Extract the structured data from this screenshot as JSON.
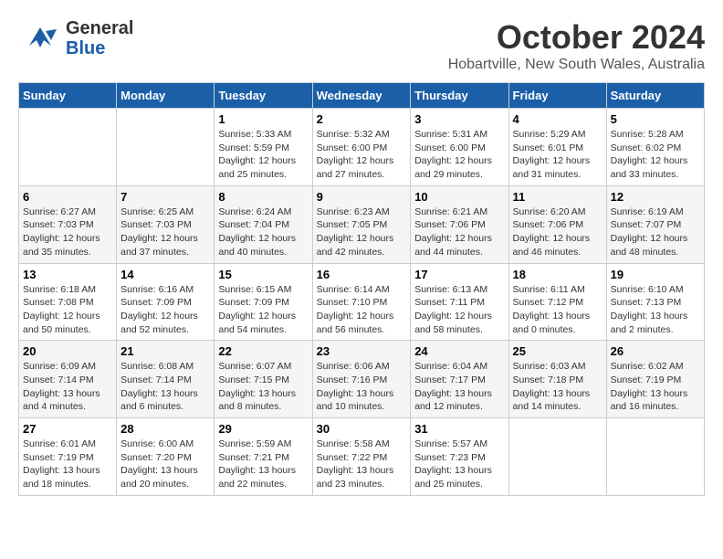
{
  "header": {
    "logo_general": "General",
    "logo_blue": "Blue",
    "month": "October 2024",
    "location": "Hobartville, New South Wales, Australia"
  },
  "days_of_week": [
    "Sunday",
    "Monday",
    "Tuesday",
    "Wednesday",
    "Thursday",
    "Friday",
    "Saturday"
  ],
  "weeks": [
    [
      {
        "day": "",
        "info": ""
      },
      {
        "day": "",
        "info": ""
      },
      {
        "day": "1",
        "info": "Sunrise: 5:33 AM\nSunset: 5:59 PM\nDaylight: 12 hours\nand 25 minutes."
      },
      {
        "day": "2",
        "info": "Sunrise: 5:32 AM\nSunset: 6:00 PM\nDaylight: 12 hours\nand 27 minutes."
      },
      {
        "day": "3",
        "info": "Sunrise: 5:31 AM\nSunset: 6:00 PM\nDaylight: 12 hours\nand 29 minutes."
      },
      {
        "day": "4",
        "info": "Sunrise: 5:29 AM\nSunset: 6:01 PM\nDaylight: 12 hours\nand 31 minutes."
      },
      {
        "day": "5",
        "info": "Sunrise: 5:28 AM\nSunset: 6:02 PM\nDaylight: 12 hours\nand 33 minutes."
      }
    ],
    [
      {
        "day": "6",
        "info": "Sunrise: 6:27 AM\nSunset: 7:03 PM\nDaylight: 12 hours\nand 35 minutes."
      },
      {
        "day": "7",
        "info": "Sunrise: 6:25 AM\nSunset: 7:03 PM\nDaylight: 12 hours\nand 37 minutes."
      },
      {
        "day": "8",
        "info": "Sunrise: 6:24 AM\nSunset: 7:04 PM\nDaylight: 12 hours\nand 40 minutes."
      },
      {
        "day": "9",
        "info": "Sunrise: 6:23 AM\nSunset: 7:05 PM\nDaylight: 12 hours\nand 42 minutes."
      },
      {
        "day": "10",
        "info": "Sunrise: 6:21 AM\nSunset: 7:06 PM\nDaylight: 12 hours\nand 44 minutes."
      },
      {
        "day": "11",
        "info": "Sunrise: 6:20 AM\nSunset: 7:06 PM\nDaylight: 12 hours\nand 46 minutes."
      },
      {
        "day": "12",
        "info": "Sunrise: 6:19 AM\nSunset: 7:07 PM\nDaylight: 12 hours\nand 48 minutes."
      }
    ],
    [
      {
        "day": "13",
        "info": "Sunrise: 6:18 AM\nSunset: 7:08 PM\nDaylight: 12 hours\nand 50 minutes."
      },
      {
        "day": "14",
        "info": "Sunrise: 6:16 AM\nSunset: 7:09 PM\nDaylight: 12 hours\nand 52 minutes."
      },
      {
        "day": "15",
        "info": "Sunrise: 6:15 AM\nSunset: 7:09 PM\nDaylight: 12 hours\nand 54 minutes."
      },
      {
        "day": "16",
        "info": "Sunrise: 6:14 AM\nSunset: 7:10 PM\nDaylight: 12 hours\nand 56 minutes."
      },
      {
        "day": "17",
        "info": "Sunrise: 6:13 AM\nSunset: 7:11 PM\nDaylight: 12 hours\nand 58 minutes."
      },
      {
        "day": "18",
        "info": "Sunrise: 6:11 AM\nSunset: 7:12 PM\nDaylight: 13 hours\nand 0 minutes."
      },
      {
        "day": "19",
        "info": "Sunrise: 6:10 AM\nSunset: 7:13 PM\nDaylight: 13 hours\nand 2 minutes."
      }
    ],
    [
      {
        "day": "20",
        "info": "Sunrise: 6:09 AM\nSunset: 7:14 PM\nDaylight: 13 hours\nand 4 minutes."
      },
      {
        "day": "21",
        "info": "Sunrise: 6:08 AM\nSunset: 7:14 PM\nDaylight: 13 hours\nand 6 minutes."
      },
      {
        "day": "22",
        "info": "Sunrise: 6:07 AM\nSunset: 7:15 PM\nDaylight: 13 hours\nand 8 minutes."
      },
      {
        "day": "23",
        "info": "Sunrise: 6:06 AM\nSunset: 7:16 PM\nDaylight: 13 hours\nand 10 minutes."
      },
      {
        "day": "24",
        "info": "Sunrise: 6:04 AM\nSunset: 7:17 PM\nDaylight: 13 hours\nand 12 minutes."
      },
      {
        "day": "25",
        "info": "Sunrise: 6:03 AM\nSunset: 7:18 PM\nDaylight: 13 hours\nand 14 minutes."
      },
      {
        "day": "26",
        "info": "Sunrise: 6:02 AM\nSunset: 7:19 PM\nDaylight: 13 hours\nand 16 minutes."
      }
    ],
    [
      {
        "day": "27",
        "info": "Sunrise: 6:01 AM\nSunset: 7:19 PM\nDaylight: 13 hours\nand 18 minutes."
      },
      {
        "day": "28",
        "info": "Sunrise: 6:00 AM\nSunset: 7:20 PM\nDaylight: 13 hours\nand 20 minutes."
      },
      {
        "day": "29",
        "info": "Sunrise: 5:59 AM\nSunset: 7:21 PM\nDaylight: 13 hours\nand 22 minutes."
      },
      {
        "day": "30",
        "info": "Sunrise: 5:58 AM\nSunset: 7:22 PM\nDaylight: 13 hours\nand 23 minutes."
      },
      {
        "day": "31",
        "info": "Sunrise: 5:57 AM\nSunset: 7:23 PM\nDaylight: 13 hours\nand 25 minutes."
      },
      {
        "day": "",
        "info": ""
      },
      {
        "day": "",
        "info": ""
      }
    ]
  ]
}
